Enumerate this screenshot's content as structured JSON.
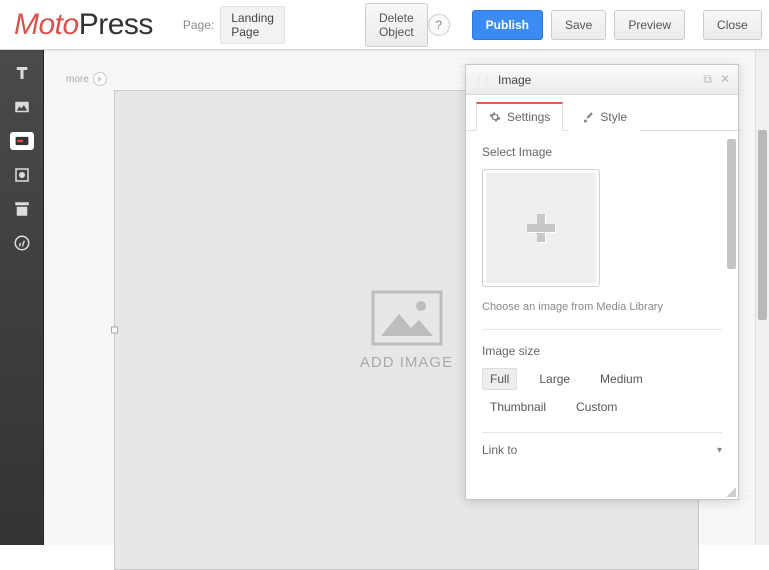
{
  "logo": {
    "prefix": "Moto",
    "suffix": "Press"
  },
  "topbar": {
    "page_label": "Page:",
    "page_name": "Landing Page",
    "delete_object": "Delete Object",
    "help": "?",
    "publish": "Publish",
    "save": "Save",
    "preview": "Preview",
    "close": "Close"
  },
  "leftrail": {
    "items": [
      {
        "name": "text-tool-icon"
      },
      {
        "name": "image-tool-icon"
      },
      {
        "name": "button-tool-icon"
      },
      {
        "name": "video-tool-icon"
      },
      {
        "name": "archive-tool-icon"
      },
      {
        "name": "wordpress-tool-icon"
      }
    ]
  },
  "canvas": {
    "more": "more",
    "add_image": "ADD IMAGE"
  },
  "panel": {
    "title": "Image",
    "tabs": {
      "settings": "Settings",
      "style": "Style"
    },
    "select_image_label": "Select Image",
    "choose_helper": "Choose an image from Media Library",
    "image_size_label": "Image size",
    "sizes": [
      "Full",
      "Large",
      "Medium",
      "Thumbnail",
      "Custom"
    ],
    "selected_size": "Full",
    "link_to_label": "Link to"
  }
}
